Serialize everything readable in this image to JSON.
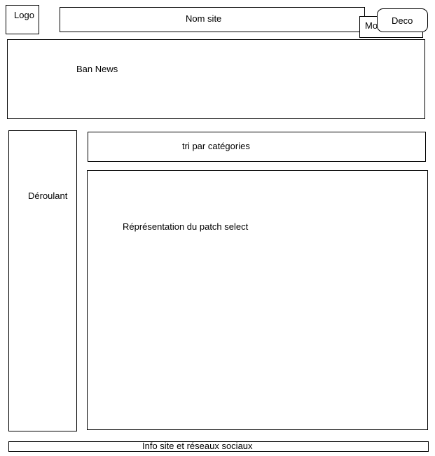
{
  "header": {
    "logo_text": "Logo",
    "site_name": "Nom site",
    "account_label": "Mon Compte",
    "logout_label": "Deco"
  },
  "banner": {
    "label": "Ban News"
  },
  "sidebar": {
    "label": "Déroulant"
  },
  "main": {
    "category_sort_label": "tri par catégories",
    "patch_view_label": "Réprésentation du patch select"
  },
  "footer": {
    "label": "Info site et réseaux sociaux"
  }
}
